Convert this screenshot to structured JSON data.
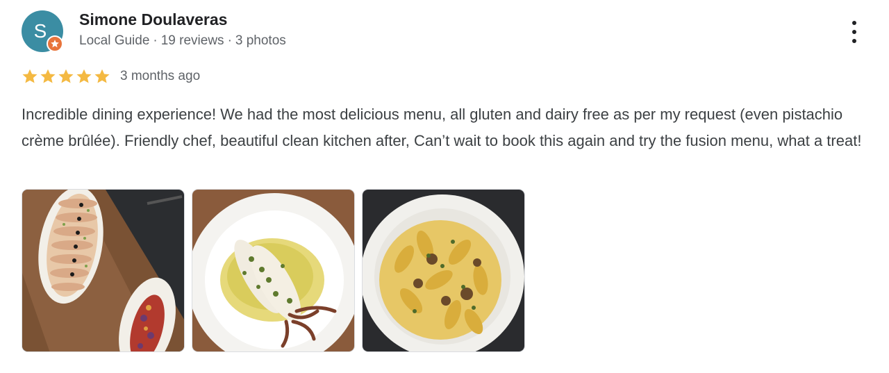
{
  "reviewer": {
    "name": "Simone Doulaveras",
    "avatar_letter": "S",
    "badge": "Local Guide",
    "reviews": "19 reviews",
    "photos": "3 photos",
    "separator": "·"
  },
  "rating": {
    "stars": 5,
    "max": 5,
    "color": "#f4b942"
  },
  "time_ago": "3 months ago",
  "review_text": "Incredible dining experience! We had the most delicious menu, all gluten and dairy free as per my request (even pistachio crème brûlée). Friendly chef, beautiful clean kitchen after, Can’t wait to book this again and try the fusion menu, what a treat!",
  "photo_items": [
    "photo-sashimi",
    "photo-squid",
    "photo-pasta"
  ],
  "icons": {
    "menu": "more-vert-icon",
    "badge": "local-guide-star-icon"
  },
  "colors": {
    "avatar": "#3b8da3",
    "badge": "#e8743b",
    "text": "#3c4043",
    "meta": "#5f6368"
  }
}
